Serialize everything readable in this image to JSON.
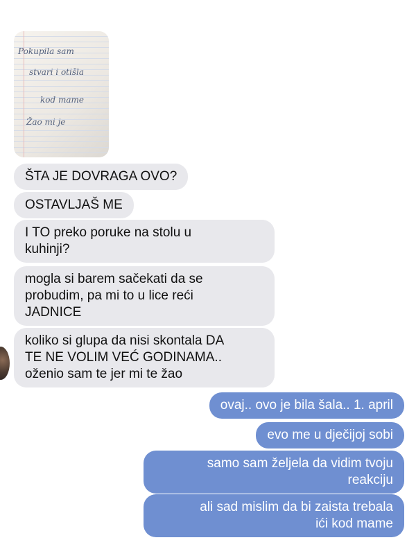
{
  "photo_note": {
    "lines": [
      "Pokupila sam",
      "stvari i otišla",
      "kod mame",
      "Žao mi je"
    ]
  },
  "messages_incoming": [
    "ŠTA JE DOVRAGA OVO?",
    "OSTAVLJAŠ ME",
    "I TO preko poruke na stolu u\nkuhinji?",
    "mogla si barem sačekati da se\nprobudim, pa mi to u lice reći\nJADNICE",
    "koliko si glupa da nisi skontala DA\nTE NE VOLIM VEĆ GODINAMA..\noženio sam te jer mi te žao"
  ],
  "messages_outgoing": [
    "ovaj.. ovo je bila šala.. 1. april",
    "evo me u dječijoj sobi",
    "samo sam željela da vidim tvoju\nreakciju",
    "ali sad mislim da bi zaista trebala\nići kod mame"
  ]
}
